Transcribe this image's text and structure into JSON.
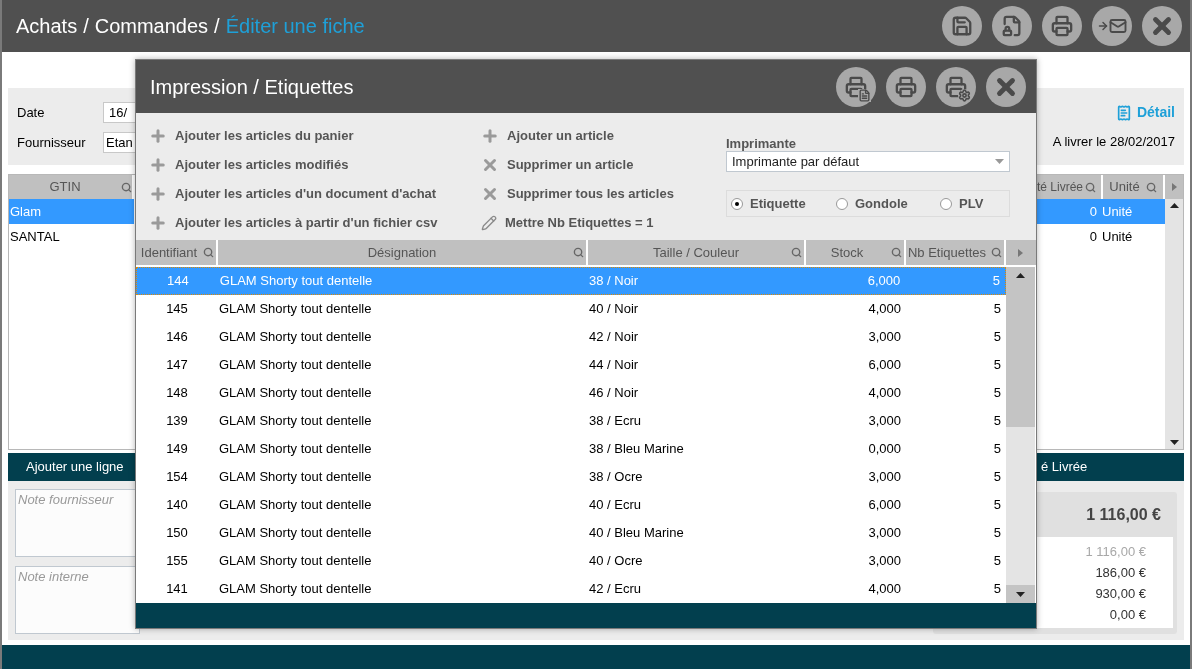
{
  "header": {
    "separator": "/",
    "breadcrumb": [
      "Achats",
      "Commandes",
      "Éditer une fiche"
    ],
    "toolbar": [
      {
        "kind": "save"
      },
      {
        "kind": "lock"
      },
      {
        "kind": "print"
      },
      {
        "kind": "mail"
      },
      {
        "kind": "close"
      }
    ]
  },
  "form": {
    "date_label": "Date",
    "date_value": "16/",
    "supplier_label": "Fournisseur",
    "supplier_value": "Etan",
    "detail_link": "Détail",
    "delivery": "A livrer le 28/02/2017"
  },
  "lines_table": {
    "columns": [
      {
        "label": "GTIN"
      },
      {
        "label": "té Livrée"
      },
      {
        "label": "Unité"
      }
    ],
    "rows": [
      {
        "gtin": "Glam",
        "quantity": "0",
        "unit": "Unité",
        "selected": true
      },
      {
        "gtin": "SANTAL",
        "quantity": "0",
        "unit": "Unité",
        "selected": false
      }
    ]
  },
  "action_bar": {
    "add_line": "Ajouter une ligne",
    "column_2": "é Livrée"
  },
  "notes": [
    {
      "placeholder": "Note fournisseur"
    },
    {
      "placeholder": "Note interne"
    }
  ],
  "totals": {
    "total": "1 116,00 €",
    "lines": [
      {
        "value": "1 116,00 €",
        "muted": true
      },
      {
        "value": "186,00 €",
        "muted": false
      },
      {
        "value": "930,00 €",
        "muted": false
      },
      {
        "value": "0,00 €",
        "muted": false
      }
    ]
  },
  "dialog": {
    "title": "Impression / Etiquettes",
    "toolbar": [
      {
        "kind": "print-list"
      },
      {
        "kind": "print"
      },
      {
        "kind": "print-settings"
      },
      {
        "kind": "close"
      }
    ],
    "actions_left": [
      {
        "kind": "add",
        "label": "Ajouter les articles du panier"
      },
      {
        "kind": "add",
        "label": "Ajouter les articles modifiés"
      },
      {
        "kind": "add",
        "label": "Ajouter les articles d'un document d'achat"
      },
      {
        "kind": "add",
        "label": "Ajouter les articles à partir d'un fichier csv"
      }
    ],
    "actions_right": [
      {
        "kind": "add",
        "label": "Ajouter un article"
      },
      {
        "kind": "remove",
        "label": "Supprimer un article"
      },
      {
        "kind": "remove",
        "label": "Supprimer tous les articles"
      },
      {
        "kind": "edit",
        "label": "Mettre Nb Etiquettes = 1"
      }
    ],
    "printer": {
      "label": "Imprimante",
      "value": "Imprimante par défaut"
    },
    "formats": [
      {
        "label": "Etiquette",
        "selected": true
      },
      {
        "label": "Gondole",
        "selected": false
      },
      {
        "label": "PLV",
        "selected": false
      }
    ],
    "table": {
      "columns": [
        "Identifiant",
        "Désignation",
        "Taille / Couleur",
        "Stock",
        "Nb Etiquettes"
      ],
      "rows": [
        {
          "id": "144",
          "designation": "GLAM Shorty tout dentelle",
          "variant": "38 / Noir",
          "stock": "6,000",
          "labels": "5",
          "selected": true
        },
        {
          "id": "145",
          "designation": "GLAM Shorty tout dentelle",
          "variant": "40 / Noir",
          "stock": "4,000",
          "labels": "5",
          "selected": false
        },
        {
          "id": "146",
          "designation": "GLAM Shorty tout dentelle",
          "variant": "42 / Noir",
          "stock": "3,000",
          "labels": "5",
          "selected": false
        },
        {
          "id": "147",
          "designation": "GLAM Shorty tout dentelle",
          "variant": "44 / Noir",
          "stock": "6,000",
          "labels": "5",
          "selected": false
        },
        {
          "id": "148",
          "designation": "GLAM Shorty tout dentelle",
          "variant": "46 / Noir",
          "stock": "4,000",
          "labels": "5",
          "selected": false
        },
        {
          "id": "139",
          "designation": "GLAM Shorty tout dentelle",
          "variant": "38 / Ecru",
          "stock": "3,000",
          "labels": "5",
          "selected": false
        },
        {
          "id": "149",
          "designation": "GLAM Shorty tout dentelle",
          "variant": "38 / Bleu Marine",
          "stock": "0,000",
          "labels": "5",
          "selected": false
        },
        {
          "id": "154",
          "designation": "GLAM Shorty tout dentelle",
          "variant": "38 / Ocre",
          "stock": "3,000",
          "labels": "5",
          "selected": false
        },
        {
          "id": "140",
          "designation": "GLAM Shorty tout dentelle",
          "variant": "40 / Ecru",
          "stock": "6,000",
          "labels": "5",
          "selected": false
        },
        {
          "id": "150",
          "designation": "GLAM Shorty tout dentelle",
          "variant": "40 / Bleu Marine",
          "stock": "3,000",
          "labels": "5",
          "selected": false
        },
        {
          "id": "155",
          "designation": "GLAM Shorty tout dentelle",
          "variant": "40 / Ocre",
          "stock": "3,000",
          "labels": "5",
          "selected": false
        },
        {
          "id": "141",
          "designation": "GLAM Shorty tout dentelle",
          "variant": "42 / Ecru",
          "stock": "4,000",
          "labels": "5",
          "selected": false
        }
      ]
    }
  }
}
